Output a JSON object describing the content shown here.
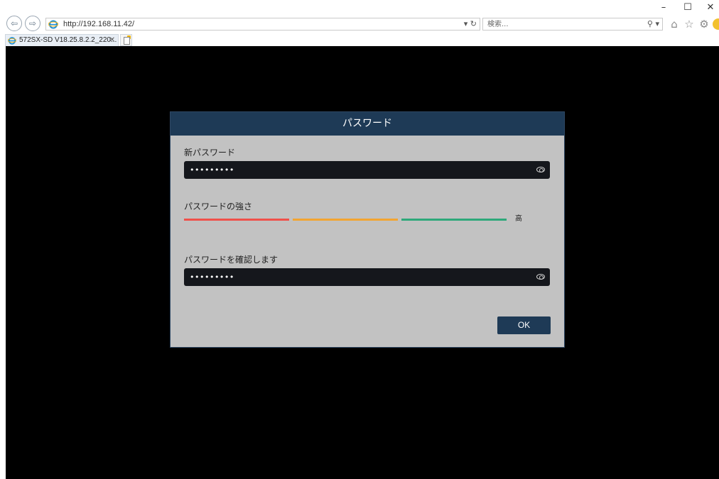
{
  "browser": {
    "url": "http://192.168.11.42/",
    "search_placeholder": "検索...",
    "tab_title": "572SX-SD V18.25.8.2.2_220...",
    "window_controls": {
      "minimize": "–",
      "maximize": "☐",
      "close": "✕"
    },
    "icons": [
      "back-icon",
      "forward-icon",
      "ie-logo-icon",
      "refresh-icon",
      "search-icon",
      "home-icon",
      "favorites-star-icon",
      "settings-gear-icon",
      "smiley-feedback-icon",
      "tab-close-icon",
      "new-tab-icon"
    ]
  },
  "dialog": {
    "title": "パスワード",
    "new_password_label": "新パスワード",
    "new_password_value": "•••••••••",
    "strength_label": "パスワードの強さ",
    "strength_level": "高",
    "strength_colors": [
      "#f0504a",
      "#f3a531",
      "#2ea87a"
    ],
    "confirm_label": "パスワードを確認します",
    "confirm_value": "•••••••••",
    "ok_label": "OK",
    "header_color": "#1e3a56",
    "body_color": "#c2c2c2"
  }
}
